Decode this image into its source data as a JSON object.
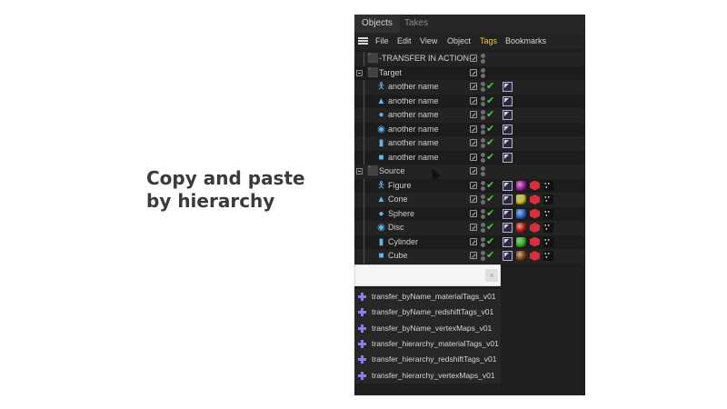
{
  "caption": {
    "line1": "Copy and paste",
    "line2": "by hierarchy"
  },
  "tabs": [
    {
      "label": "Objects",
      "active": true
    },
    {
      "label": "Takes",
      "active": false
    }
  ],
  "menu": [
    {
      "label": "File",
      "active": false
    },
    {
      "label": "Edit",
      "active": false
    },
    {
      "label": "View",
      "active": false
    },
    {
      "label": "Object",
      "active": false
    },
    {
      "label": "Tags",
      "active": true
    },
    {
      "label": "Bookmarks",
      "active": false
    }
  ],
  "tree": [
    {
      "label": "-TRANSFER IN ACTION-",
      "icon": "null-object-icon",
      "level": 0,
      "check": false,
      "tags": []
    },
    {
      "label": "Target",
      "icon": "group-null-icon",
      "level": 0,
      "collapse": true,
      "check": false,
      "tags": []
    },
    {
      "label": "another name",
      "icon": "figure-icon",
      "level": 1,
      "check": true,
      "tags": [
        "flag"
      ]
    },
    {
      "label": "another name",
      "icon": "cone-icon",
      "level": 1,
      "check": true,
      "tags": [
        "flag"
      ]
    },
    {
      "label": "another name",
      "icon": "sphere-icon",
      "level": 1,
      "check": true,
      "tags": [
        "flag"
      ]
    },
    {
      "label": "another name",
      "icon": "disc-icon",
      "level": 1,
      "check": true,
      "tags": [
        "flag"
      ]
    },
    {
      "label": "another name",
      "icon": "cylinder-icon",
      "level": 1,
      "check": true,
      "tags": [
        "flag"
      ]
    },
    {
      "label": "another name",
      "icon": "cube-icon",
      "level": 1,
      "check": true,
      "tags": [
        "flag"
      ]
    },
    {
      "label": "Source",
      "icon": "group-null-icon",
      "level": 0,
      "collapse": true,
      "check": false,
      "tags": []
    },
    {
      "label": "Figure",
      "icon": "figure-icon",
      "level": 1,
      "check": true,
      "tags": [
        "flag",
        "#b020b0",
        "cube",
        "dotsq"
      ]
    },
    {
      "label": "Cone",
      "icon": "cone-icon",
      "level": 1,
      "check": true,
      "tags": [
        "flag",
        "#c9c22a",
        "cube",
        "dotsq"
      ]
    },
    {
      "label": "Sphere",
      "icon": "sphere-icon",
      "level": 1,
      "check": true,
      "tags": [
        "flag",
        "#2a6fd6",
        "cube",
        "dotsq"
      ]
    },
    {
      "label": "Disc",
      "icon": "disc-icon",
      "level": 1,
      "check": true,
      "tags": [
        "flag",
        "#cc1c1c",
        "cube",
        "dotsq"
      ]
    },
    {
      "label": "Cylinder",
      "icon": "cylinder-icon",
      "level": 1,
      "check": true,
      "tags": [
        "flag",
        "#38b82a",
        "cube",
        "dotsq"
      ]
    },
    {
      "label": "Cube",
      "icon": "cube-icon",
      "level": 1,
      "check": true,
      "tags": [
        "flag",
        "#8a4a1a",
        "cube",
        "dotsq"
      ]
    }
  ],
  "search": {
    "value": "",
    "clear_label": "×"
  },
  "results": [
    "transfer_byName_materialTags_v01",
    "transfer_byName_redshiftTags_v01",
    "transfer_byName_vertexMaps_v01",
    "transfer_hierarchy_materialTags_v01",
    "transfer_hierarchy_redshiftTags_v01",
    "transfer_hierarchy_vertexMaps_v01"
  ],
  "colors": {
    "check": "#49c94a",
    "tags_active": "#e8c84a",
    "result_icon": "#8d7ce8"
  }
}
